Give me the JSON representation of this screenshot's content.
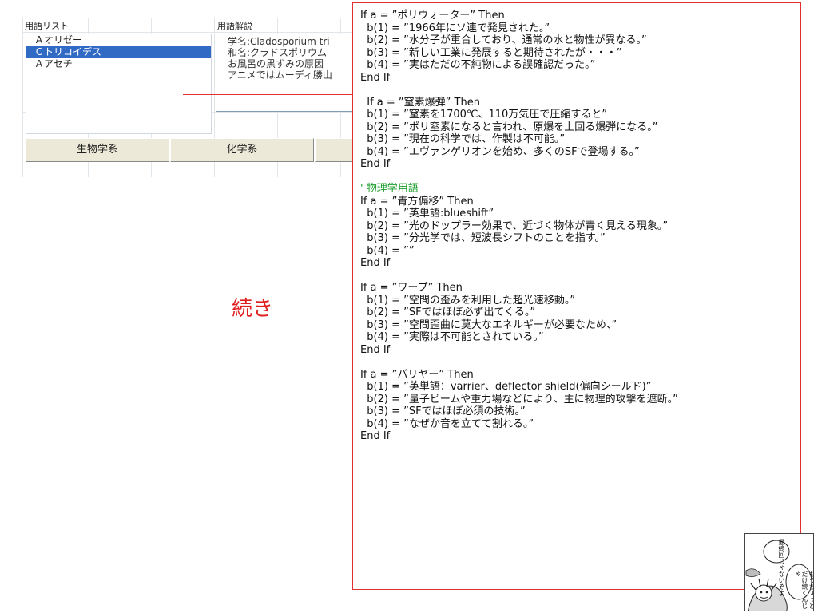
{
  "spreadsheet": {
    "header_term_list": "用語リスト",
    "header_term_desc": "用語解説",
    "list_items": [
      {
        "label": "Ａオリゼー",
        "selected": false
      },
      {
        "label": "Ｃトリコイデス",
        "selected": true
      },
      {
        "label": "Ａアセチ",
        "selected": false
      }
    ],
    "desc_lines": [
      "学名:Cladosporium tri",
      "和名:クラドスポリウム",
      "お風呂の黒ずみの原因",
      "アニメではムーディ勝山"
    ],
    "tabs": {
      "biology": "生物学系",
      "chemistry": "化学系",
      "third": ""
    }
  },
  "continued_label": "続き",
  "code": {
    "lines": [
      {
        "text": "If a = ”ポリウォーター” Then",
        "kind": "code"
      },
      {
        "text": "  b(1) = ”1966年にソ連で発見された。”",
        "kind": "code"
      },
      {
        "text": "  b(2) = ”水分子が重合しており、通常の水と物性が異なる。”",
        "kind": "code"
      },
      {
        "text": "  b(3) = ”新しい工業に発展すると期待されたが・・・”",
        "kind": "code"
      },
      {
        "text": "  b(4) = ”実はただの不純物による誤確認だった。”",
        "kind": "code"
      },
      {
        "text": "End If",
        "kind": "code"
      },
      {
        "text": "",
        "kind": "blank"
      },
      {
        "text": "  If a = ”窒素爆弾” Then",
        "kind": "code"
      },
      {
        "text": "  b(1) = ”窒素を1700℃、110万気圧で圧縮すると”",
        "kind": "code"
      },
      {
        "text": "  b(2) = ”ポリ窒素になると言われ、原爆を上回る爆弾になる。”",
        "kind": "code"
      },
      {
        "text": "  b(3) = ”現在の科学では、作製は不可能。”",
        "kind": "code"
      },
      {
        "text": "  b(4) = ”エヴァンゲリオンを始め、多くのSFで登場する。”",
        "kind": "code"
      },
      {
        "text": "End If",
        "kind": "code"
      },
      {
        "text": "",
        "kind": "blank"
      },
      {
        "text": "' 物理学用語",
        "kind": "comment"
      },
      {
        "text": "If a = ”青方偏移” Then",
        "kind": "code"
      },
      {
        "text": "  b(1) = ”英単語:blueshift”",
        "kind": "code"
      },
      {
        "text": "  b(2) = ”光のドップラー効果で、近づく物体が青く見える現象。”",
        "kind": "code"
      },
      {
        "text": "  b(3) = ”分光学では、短波長シフトのことを指す。”",
        "kind": "code"
      },
      {
        "text": "  b(4) = ””",
        "kind": "code"
      },
      {
        "text": "End If",
        "kind": "code"
      },
      {
        "text": "",
        "kind": "blank"
      },
      {
        "text": "If a = ”ワープ” Then",
        "kind": "code"
      },
      {
        "text": "  b(1) = ”空間の歪みを利用した超光速移動。”",
        "kind": "code"
      },
      {
        "text": "  b(2) = ”SFではほぼ必ず出てくる。”",
        "kind": "code"
      },
      {
        "text": "  b(3) = ”空間歪曲に莫大なエネルギーが必要なため、”",
        "kind": "code"
      },
      {
        "text": "  b(4) = ”実際は不可能とされている。”",
        "kind": "code"
      },
      {
        "text": "End If",
        "kind": "code"
      },
      {
        "text": "",
        "kind": "blank"
      },
      {
        "text": "If a = ”バリヤー” Then",
        "kind": "code"
      },
      {
        "text": "  b(1) = ”英単語：varrier、deflector shield(偏向シールド)”",
        "kind": "code"
      },
      {
        "text": "  b(2) = ”量子ビームや重力場などにより、主に物理的攻撃を遮断。”",
        "kind": "code"
      },
      {
        "text": "  b(3) = ”SFではほぼ必須の技術。”",
        "kind": "code"
      },
      {
        "text": "  b(4) = ”なぜか音を立てて割れる。”",
        "kind": "code"
      },
      {
        "text": "End If",
        "kind": "code"
      }
    ]
  },
  "manga": {
    "bubble_a": "最終回じゃないぞよ",
    "bubble_b": "もうちょっとだけ続くんじゃ"
  }
}
